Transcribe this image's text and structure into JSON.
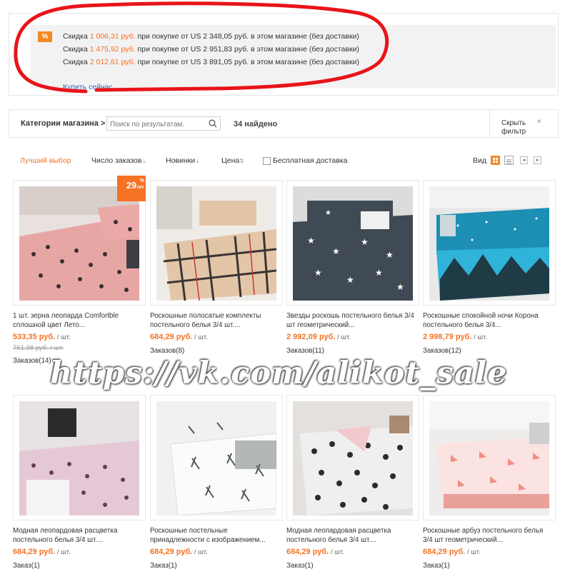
{
  "promo": {
    "badge": "%",
    "lines": [
      {
        "prefix": "Скидка ",
        "amount": "1 006,31 руб.",
        "suffix": " при покупке от US 2 348,05 руб. в этом магазине (без доставки)"
      },
      {
        "prefix": "Скидка ",
        "amount": "1 475,92 руб.",
        "suffix": " при покупке от US 2 951,83 руб. в этом магазине (без доставки)"
      },
      {
        "prefix": "Скидка ",
        "amount": "2 012,61 руб.",
        "suffix": " при покупке от US 3 891,05 руб. в этом магазине (без доставки)"
      }
    ],
    "buy_now": "Купить сейчас"
  },
  "filter": {
    "category_label": "Категории магазина >",
    "search_placeholder": "Поиск по результатам.",
    "found": "34 найдено",
    "hide_filter": "Скрыть фильтр"
  },
  "sort": {
    "best": "Лучший выбор",
    "orders": "Число заказов",
    "new": "Новинки",
    "price": "Цена",
    "free_shipping": "Бесплатная доставка",
    "view_label": "Вид"
  },
  "products": [
    {
      "title": "1 шт. зерна леопарда Comfortble сплошной цвет Лето...",
      "price": "533,35 руб.",
      "unit": " / шт.",
      "old_price": "751,38 руб. / шт.",
      "orders": "Заказов(14)",
      "discount": "29"
    },
    {
      "title": "Роскошные полосатые комплекты постельного белья 3/4 шт....",
      "price": "684,29 руб.",
      "unit": " / шт.",
      "orders": "Заказов(8)"
    },
    {
      "title": "Звезды роскошь постельного белья 3/4 шт геометрический...",
      "price": "2 992,09 руб.",
      "unit": " / шт.",
      "orders": "Заказов(11)"
    },
    {
      "title": "Роскошные спокойной ночи Корона постельного белья 3/4...",
      "price": "2 998,79 руб.",
      "unit": " / шт.",
      "orders": "Заказов(12)"
    },
    {
      "title": "Модная леопардовая расцветка постельного белья 3/4 шт....",
      "price": "684,29 руб.",
      "unit": " / шт.",
      "orders": "Заказ(1)"
    },
    {
      "title": "Роскошные постельные принадлежности с изображением...",
      "price": "684,29 руб.",
      "unit": " / шт.",
      "orders": "Заказ(1)"
    },
    {
      "title": "Модная леопардовая расцветка постельного белья 3/4 шт....",
      "price": "684,29 руб.",
      "unit": " / шт.",
      "orders": "Заказ(1)"
    },
    {
      "title": "Роскошные арбуз постельного белья 3/4 шт геометрический...",
      "price": "684,29 руб.",
      "unit": " / шт.",
      "orders": "Заказ(1)"
    }
  ],
  "watermark": "https://vk.com/alikot_sale",
  "colors": {
    "accent": "#f57224",
    "link": "#2a67b8",
    "annotation": "#e8141a"
  }
}
